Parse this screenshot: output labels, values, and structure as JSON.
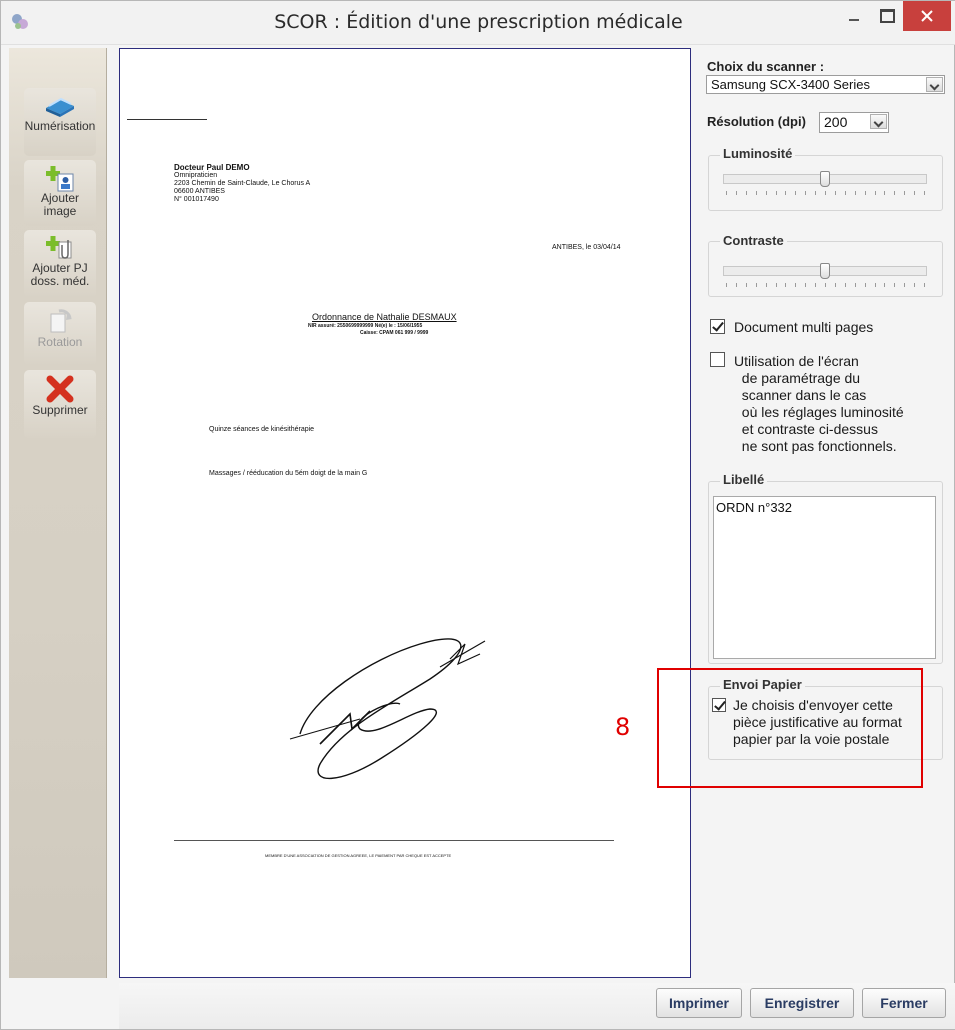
{
  "window": {
    "title": "SCOR : Édition d'une prescription médicale"
  },
  "toolbar": {
    "items": [
      {
        "label": "Numérisation",
        "icon": "scanner-icon"
      },
      {
        "label": "Ajouter image",
        "icon": "add-image-icon"
      },
      {
        "label": "Ajouter PJ doss. méd.",
        "icon": "add-attachment-icon"
      },
      {
        "label": "Rotation",
        "icon": "rotate-icon",
        "disabled": true
      },
      {
        "label": "Supprimer",
        "icon": "delete-icon"
      }
    ]
  },
  "document": {
    "doctor_name": "Docteur Paul DEMO",
    "doctor_title": "Omnipraticien",
    "doctor_address": "2203 Chemin de Saint-Claude, Le Chorus A",
    "doctor_city": "06600 ANTIBES",
    "doctor_number": "N° 001017490",
    "place_date": "ANTIBES, le 03/04/14",
    "ordonnance_title": "Ordonnance de Nathalie DESMAUX",
    "nir_line": "NIR assuré: 2550699999999  Né(e) le : 15/06/1955",
    "caisse_line": "Caisse: CPAM 061 999 / 9999",
    "line1": "Quinze séances de kinésithérapie",
    "line2": "Massages / rééducation du 5ém doigt de la main G",
    "footer": "MEMBRE D'UNE ASSOCIATION DE GESTION AGREEE, LE PAIEMENT PAR CHEQUE EST ACCEPTE"
  },
  "settings": {
    "scanner_label": "Choix du scanner :",
    "scanner_value": "Samsung SCX-3400 Series",
    "resolution_label": "Résolution (dpi)",
    "resolution_value": "200",
    "luminosite_label": "Luminosité",
    "luminosite_value": 0.5,
    "contraste_label": "Contraste",
    "contraste_value": 0.5,
    "multipage_label": "Document multi pages",
    "multipage_checked": true,
    "ecran_label": "Utilisation de l'écran\n  de paramétrage du\n  scanner dans le cas\n  où les réglages luminosité\n  et contraste ci-dessus\n  ne sont pas fonctionnels.",
    "ecran_checked": false,
    "libelle_label": "Libellé",
    "libelle_value": "ORDN n°332",
    "envoi_label": "Envoi Papier",
    "envoi_text": "Je choisis d'envoyer cette\npièce justificative au format\npapier par la voie postale",
    "envoi_checked": true
  },
  "annotation": {
    "number": "8",
    "color": "#e00000"
  },
  "actions": {
    "imprimer": "Imprimer",
    "enregistrer": "Enregistrer",
    "fermer": "Fermer"
  }
}
